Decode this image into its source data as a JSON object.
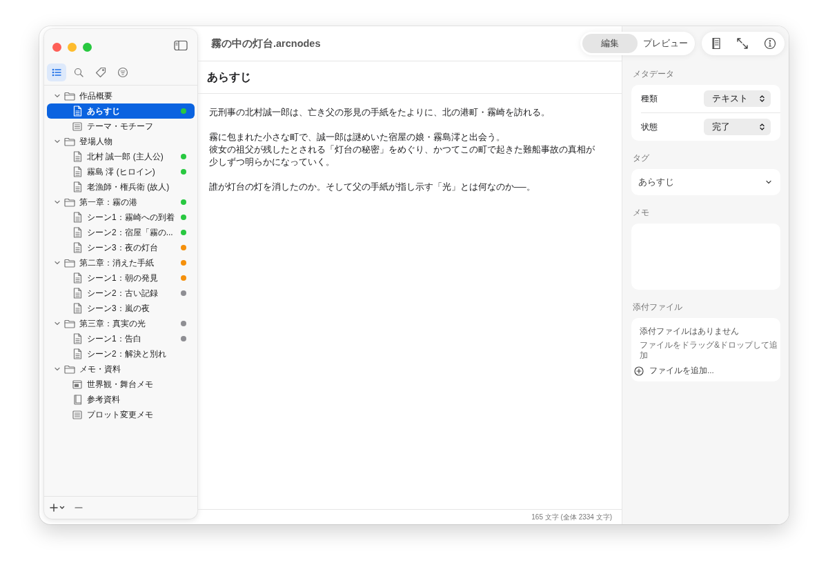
{
  "window": {
    "title": "霧の中の灯台.arcnodes"
  },
  "sidebar": {
    "tabs": [
      {
        "kind": "outline",
        "selected": true
      },
      {
        "kind": "search",
        "selected": false
      },
      {
        "kind": "tag",
        "selected": false
      },
      {
        "kind": "filter",
        "selected": false
      }
    ],
    "tree": [
      {
        "kind": "folder",
        "label": "作品概要",
        "expanded": true,
        "selected": false,
        "children": [
          {
            "kind": "doc",
            "label": "あらすじ",
            "selected": true,
            "color": "#28c840"
          },
          {
            "kind": "note",
            "label": "テーマ・モチーフ",
            "selected": false
          }
        ]
      },
      {
        "kind": "folder",
        "label": "登場人物",
        "expanded": true,
        "selected": false,
        "children": [
          {
            "kind": "doc",
            "label": "北村 誠一郎 (主人公)",
            "selected": false,
            "color": "#28c840"
          },
          {
            "kind": "doc",
            "label": "霧島 澪 (ヒロイン)",
            "selected": false,
            "color": "#28c840"
          },
          {
            "kind": "doc",
            "label": "老漁師・権兵衛 (故人)",
            "selected": false
          }
        ]
      },
      {
        "kind": "folder",
        "label": "第一章：霧の港",
        "expanded": true,
        "selected": false,
        "color": "#28c840",
        "children": [
          {
            "kind": "doc",
            "label": "シーン1：霧崎への到着",
            "selected": false,
            "color": "#28c840"
          },
          {
            "kind": "doc",
            "label": "シーン2：宿屋「霧の...",
            "selected": false,
            "color": "#28c840"
          },
          {
            "kind": "doc",
            "label": "シーン3：夜の灯台",
            "selected": false,
            "color": "#f5900b"
          }
        ]
      },
      {
        "kind": "folder",
        "label": "第二章：消えた手紙",
        "expanded": true,
        "selected": false,
        "color": "#f5900b",
        "children": [
          {
            "kind": "doc",
            "label": "シーン1：朝の発見",
            "selected": false,
            "color": "#f5900b"
          },
          {
            "kind": "doc",
            "label": "シーン2：古い記録",
            "selected": false,
            "color": "#8e8e93"
          },
          {
            "kind": "doc",
            "label": "シーン3：嵐の夜",
            "selected": false
          }
        ]
      },
      {
        "kind": "folder",
        "label": "第三章：真実の光",
        "expanded": true,
        "selected": false,
        "color": "#8e8e93",
        "children": [
          {
            "kind": "doc",
            "label": "シーン1：告白",
            "selected": false,
            "color": "#8e8e93"
          },
          {
            "kind": "doc",
            "label": "シーン2：解決と別れ",
            "selected": false
          }
        ]
      },
      {
        "kind": "folder",
        "label": "メモ・資料",
        "expanded": true,
        "selected": false,
        "children": [
          {
            "kind": "sheet",
            "label": "世界観・舞台メモ",
            "selected": false
          },
          {
            "kind": "book",
            "label": "参考資料",
            "selected": false
          },
          {
            "kind": "note",
            "label": "プロット変更メモ",
            "selected": false
          }
        ]
      }
    ]
  },
  "mode_tabs": [
    {
      "label": "編集",
      "selected": true
    },
    {
      "label": "プレビュー",
      "selected": false
    }
  ],
  "document": {
    "title": "あらすじ",
    "paragraphs": [
      [
        "元刑事の北村誠一郎は、亡き父の形見の手紙をたよりに、北の港町・霧崎を訪れる。"
      ],
      [
        "霧に包まれた小さな町で、誠一郎は謎めいた宿屋の娘・霧島澪と出会う。",
        "彼女の祖父が残したとされる「灯台の秘密」をめぐり、かつてこの町で起きた難船事故の真相が",
        "少しずつ明らかになっていく。"
      ],
      [
        "誰が灯台の灯を消したのか。そして父の手紙が指し示す「光」とは何なのか──。"
      ]
    ]
  },
  "status_bar": "165 文字 (全体 2334 文字)",
  "inspector": {
    "metadata_label": "メタデータ",
    "metadata": [
      {
        "label": "種類",
        "value": "テキスト"
      },
      {
        "label": "状態",
        "value": "完了"
      }
    ],
    "tags_label": "タグ",
    "tags_value": "あらすじ",
    "memo_label": "メモ",
    "attachments_label": "添付ファイル",
    "attachments_empty": "添付ファイルはありません",
    "attachments_hint": "ファイルをドラッグ&ドロップして追加",
    "add_file": "ファイルを追加..."
  }
}
